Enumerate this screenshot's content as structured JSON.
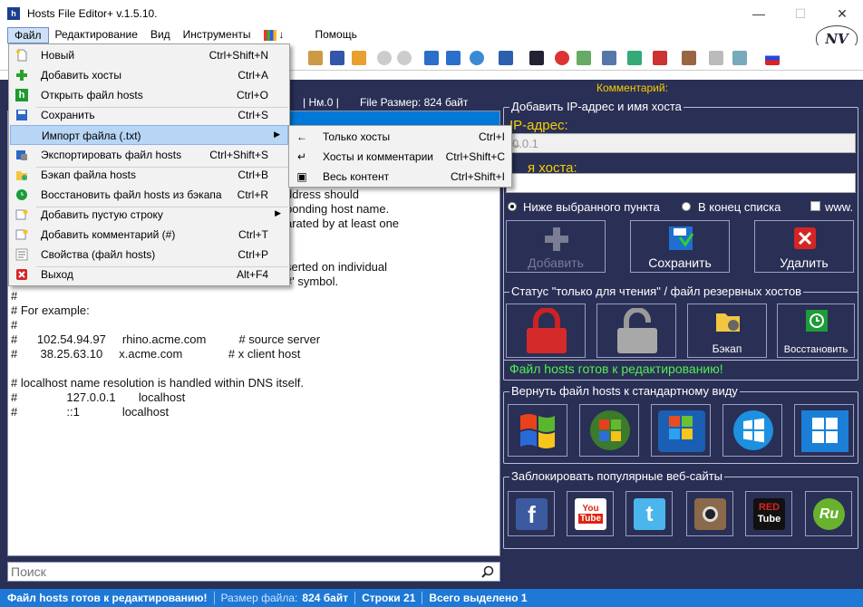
{
  "window": {
    "title": "Hosts File Editor+ v.1.5.10.",
    "app_icon_letter": "h",
    "logo_text": "NV"
  },
  "menubar": {
    "items": [
      "Файл",
      "Редактирование",
      "Вид",
      "Инструменты",
      "↓",
      "Помощь"
    ]
  },
  "file_menu": {
    "items": [
      {
        "label": "Новый",
        "shortcut": "Ctrl+Shift+N",
        "icon": "new-file-icon"
      },
      {
        "label": "Добавить хосты",
        "shortcut": "Ctrl+A",
        "icon": "plus-icon"
      },
      {
        "label": "Открыть файл hosts",
        "shortcut": "Ctrl+O",
        "icon": "hosts-h-icon"
      },
      {
        "label": "Сохранить",
        "shortcut": "Ctrl+S",
        "icon": "save-icon"
      },
      {
        "label": "Импорт файла (.txt)",
        "shortcut": "",
        "icon": "",
        "submenu": true
      },
      {
        "label": "Экспортировать файл hosts",
        "shortcut": "Ctrl+Shift+S",
        "icon": "export-icon"
      },
      {
        "label": "Бэкап файла hosts",
        "shortcut": "Ctrl+B",
        "icon": "backup-icon"
      },
      {
        "label": "Восстановить файл hosts из бэкапа",
        "shortcut": "Ctrl+R",
        "icon": "restore-icon"
      },
      {
        "label": "Добавить пустую строку",
        "shortcut": "",
        "icon": "blank-line-icon",
        "submenu": true
      },
      {
        "label": "Добавить комментарий (#)",
        "shortcut": "Ctrl+T",
        "icon": "comment-icon"
      },
      {
        "label": "Свойства (файл hosts)",
        "shortcut": "Ctrl+P",
        "icon": "properties-icon"
      },
      {
        "label": "Выход",
        "shortcut": "Alt+F4",
        "icon": "exit-icon"
      }
    ]
  },
  "import_submenu": {
    "items": [
      {
        "label": "Только хосты",
        "shortcut": "Ctrl+I"
      },
      {
        "label": "Хосты и комментарии",
        "shortcut": "Ctrl+Shift+C"
      },
      {
        "label": "Весь контент",
        "shortcut": "Ctrl+Shift+I"
      }
    ]
  },
  "editor": {
    "header_nm": "| Нм.0 |",
    "header_size": "File Размер: 824 байт",
    "lines": [
      "ddress should",
      "ponding host name.",
      "arated by at least one",
      "",
      "",
      "serted on individual",
      "#' symbol.",
      "#",
      "# For example:",
      "#",
      "#      102.54.94.97     rhino.acme.com          # source server",
      "#       38.25.63.10     x.acme.com              # x client host",
      "",
      "# localhost name resolution is handled within DNS itself.",
      "#               127.0.0.1       localhost",
      "#               ::1             localhost"
    ],
    "search_placeholder": "Поиск"
  },
  "right_panel": {
    "comment_label": "Комментарий:",
    "add_group_title": "Добавить IP-адрес и имя хоста",
    "ip_label": "IP-адрес:",
    "ip_value": "0.0.1",
    "host_label": "я хоста:",
    "radio_below": "Ниже выбранного пункта",
    "radio_end": "В конец списка",
    "check_www": "www.",
    "btn_add": "Добавить",
    "btn_save": "Сохранить",
    "btn_delete": "Удалить",
    "status_group_title": "Статус \"только для чтения\" / файл резервных хостов",
    "btn_backup": "Бэкап",
    "btn_restore": "Восстановить",
    "status_ok": "Файл hosts готов к редактированию!",
    "restore_group_title": "Вернуть файл hosts к стандартному виду",
    "os_buttons": [
      "XP",
      "Vista",
      "Windows 7",
      "Windows 8",
      "Windows 10"
    ],
    "block_group_title": "Заблокировать популярные веб-сайты",
    "site_buttons": [
      "f",
      "You Tube",
      "t",
      "insta",
      "RED Tube",
      "Ru"
    ]
  },
  "statusbar": {
    "message": "Файл hosts готов к редактированию!",
    "size_label": "Размер файла:",
    "size_value": "824 байт",
    "lines": "Строки 21",
    "selected": "Всего выделено 1"
  },
  "colors": {
    "panel_bg": "#2a2f55",
    "accent_yellow": "#f6d000",
    "status_green": "#4ff04f",
    "statusbar_blue": "#1e78d6"
  }
}
